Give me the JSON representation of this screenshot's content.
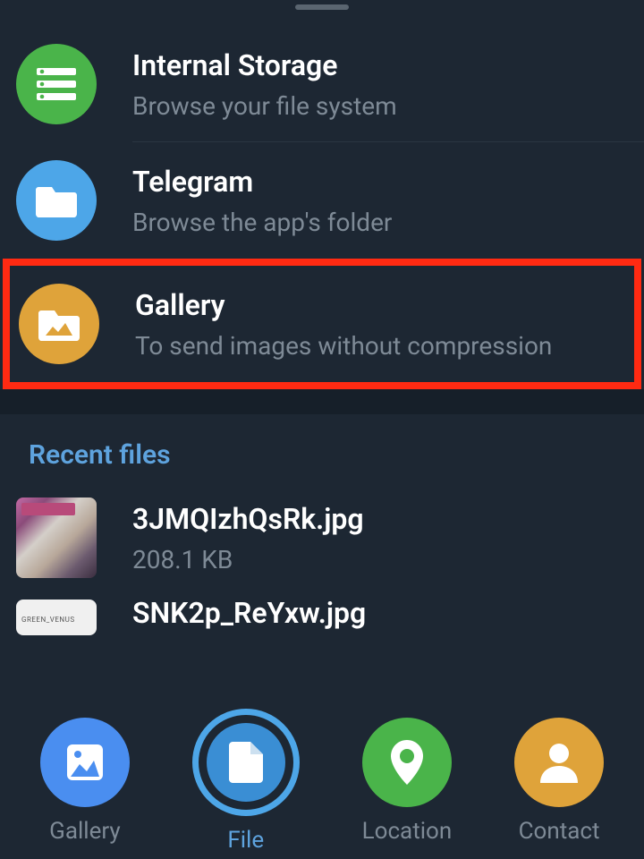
{
  "sources": [
    {
      "title": "Internal Storage",
      "subtitle": "Browse your file system",
      "icon": "storage-icon",
      "color": "green"
    },
    {
      "title": "Telegram",
      "subtitle": "Browse the app's folder",
      "icon": "folder-icon",
      "color": "blue"
    },
    {
      "title": "Gallery",
      "subtitle": "To send images without compression",
      "icon": "gallery-folder-icon",
      "color": "orange",
      "highlighted": true
    }
  ],
  "recent_header": "Recent files",
  "recent_files": [
    {
      "name": "3JMQIzhQsRk.jpg",
      "size": "208.1 KB"
    },
    {
      "name": "SNK2p_ReYxw.jpg",
      "size": ""
    }
  ],
  "tabs": [
    {
      "label": "Gallery",
      "icon": "image-icon",
      "color": "blue",
      "selected": false
    },
    {
      "label": "File",
      "icon": "file-icon",
      "color": "blue-dark",
      "selected": true
    },
    {
      "label": "Location",
      "icon": "location-pin-icon",
      "color": "green",
      "selected": false
    },
    {
      "label": "Contact",
      "icon": "person-icon",
      "color": "orange",
      "selected": false
    }
  ]
}
